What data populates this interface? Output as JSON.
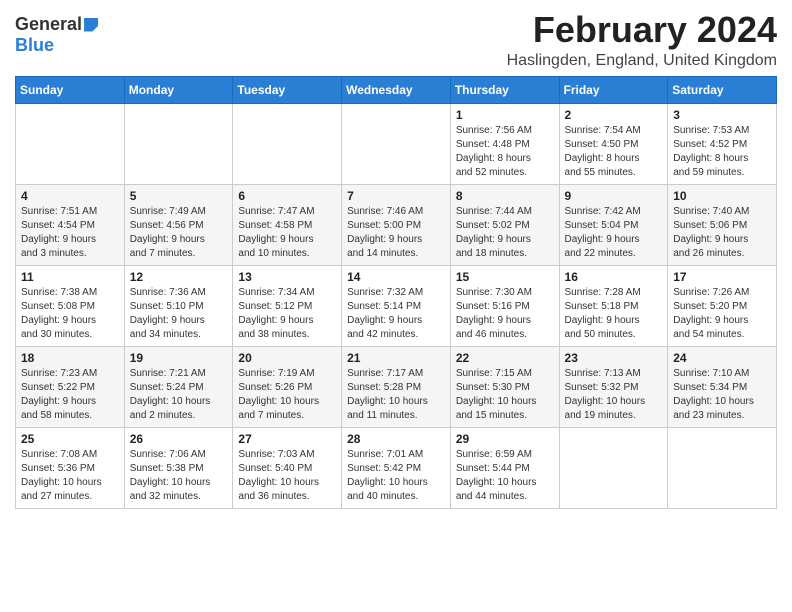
{
  "header": {
    "logo_general": "General",
    "logo_blue": "Blue",
    "month_title": "February 2024",
    "location": "Haslingden, England, United Kingdom"
  },
  "days_of_week": [
    "Sunday",
    "Monday",
    "Tuesday",
    "Wednesday",
    "Thursday",
    "Friday",
    "Saturday"
  ],
  "weeks": [
    [
      {
        "day": "",
        "info": ""
      },
      {
        "day": "",
        "info": ""
      },
      {
        "day": "",
        "info": ""
      },
      {
        "day": "",
        "info": ""
      },
      {
        "day": "1",
        "info": "Sunrise: 7:56 AM\nSunset: 4:48 PM\nDaylight: 8 hours\nand 52 minutes."
      },
      {
        "day": "2",
        "info": "Sunrise: 7:54 AM\nSunset: 4:50 PM\nDaylight: 8 hours\nand 55 minutes."
      },
      {
        "day": "3",
        "info": "Sunrise: 7:53 AM\nSunset: 4:52 PM\nDaylight: 8 hours\nand 59 minutes."
      }
    ],
    [
      {
        "day": "4",
        "info": "Sunrise: 7:51 AM\nSunset: 4:54 PM\nDaylight: 9 hours\nand 3 minutes."
      },
      {
        "day": "5",
        "info": "Sunrise: 7:49 AM\nSunset: 4:56 PM\nDaylight: 9 hours\nand 7 minutes."
      },
      {
        "day": "6",
        "info": "Sunrise: 7:47 AM\nSunset: 4:58 PM\nDaylight: 9 hours\nand 10 minutes."
      },
      {
        "day": "7",
        "info": "Sunrise: 7:46 AM\nSunset: 5:00 PM\nDaylight: 9 hours\nand 14 minutes."
      },
      {
        "day": "8",
        "info": "Sunrise: 7:44 AM\nSunset: 5:02 PM\nDaylight: 9 hours\nand 18 minutes."
      },
      {
        "day": "9",
        "info": "Sunrise: 7:42 AM\nSunset: 5:04 PM\nDaylight: 9 hours\nand 22 minutes."
      },
      {
        "day": "10",
        "info": "Sunrise: 7:40 AM\nSunset: 5:06 PM\nDaylight: 9 hours\nand 26 minutes."
      }
    ],
    [
      {
        "day": "11",
        "info": "Sunrise: 7:38 AM\nSunset: 5:08 PM\nDaylight: 9 hours\nand 30 minutes."
      },
      {
        "day": "12",
        "info": "Sunrise: 7:36 AM\nSunset: 5:10 PM\nDaylight: 9 hours\nand 34 minutes."
      },
      {
        "day": "13",
        "info": "Sunrise: 7:34 AM\nSunset: 5:12 PM\nDaylight: 9 hours\nand 38 minutes."
      },
      {
        "day": "14",
        "info": "Sunrise: 7:32 AM\nSunset: 5:14 PM\nDaylight: 9 hours\nand 42 minutes."
      },
      {
        "day": "15",
        "info": "Sunrise: 7:30 AM\nSunset: 5:16 PM\nDaylight: 9 hours\nand 46 minutes."
      },
      {
        "day": "16",
        "info": "Sunrise: 7:28 AM\nSunset: 5:18 PM\nDaylight: 9 hours\nand 50 minutes."
      },
      {
        "day": "17",
        "info": "Sunrise: 7:26 AM\nSunset: 5:20 PM\nDaylight: 9 hours\nand 54 minutes."
      }
    ],
    [
      {
        "day": "18",
        "info": "Sunrise: 7:23 AM\nSunset: 5:22 PM\nDaylight: 9 hours\nand 58 minutes."
      },
      {
        "day": "19",
        "info": "Sunrise: 7:21 AM\nSunset: 5:24 PM\nDaylight: 10 hours\nand 2 minutes."
      },
      {
        "day": "20",
        "info": "Sunrise: 7:19 AM\nSunset: 5:26 PM\nDaylight: 10 hours\nand 7 minutes."
      },
      {
        "day": "21",
        "info": "Sunrise: 7:17 AM\nSunset: 5:28 PM\nDaylight: 10 hours\nand 11 minutes."
      },
      {
        "day": "22",
        "info": "Sunrise: 7:15 AM\nSunset: 5:30 PM\nDaylight: 10 hours\nand 15 minutes."
      },
      {
        "day": "23",
        "info": "Sunrise: 7:13 AM\nSunset: 5:32 PM\nDaylight: 10 hours\nand 19 minutes."
      },
      {
        "day": "24",
        "info": "Sunrise: 7:10 AM\nSunset: 5:34 PM\nDaylight: 10 hours\nand 23 minutes."
      }
    ],
    [
      {
        "day": "25",
        "info": "Sunrise: 7:08 AM\nSunset: 5:36 PM\nDaylight: 10 hours\nand 27 minutes."
      },
      {
        "day": "26",
        "info": "Sunrise: 7:06 AM\nSunset: 5:38 PM\nDaylight: 10 hours\nand 32 minutes."
      },
      {
        "day": "27",
        "info": "Sunrise: 7:03 AM\nSunset: 5:40 PM\nDaylight: 10 hours\nand 36 minutes."
      },
      {
        "day": "28",
        "info": "Sunrise: 7:01 AM\nSunset: 5:42 PM\nDaylight: 10 hours\nand 40 minutes."
      },
      {
        "day": "29",
        "info": "Sunrise: 6:59 AM\nSunset: 5:44 PM\nDaylight: 10 hours\nand 44 minutes."
      },
      {
        "day": "",
        "info": ""
      },
      {
        "day": "",
        "info": ""
      }
    ]
  ]
}
